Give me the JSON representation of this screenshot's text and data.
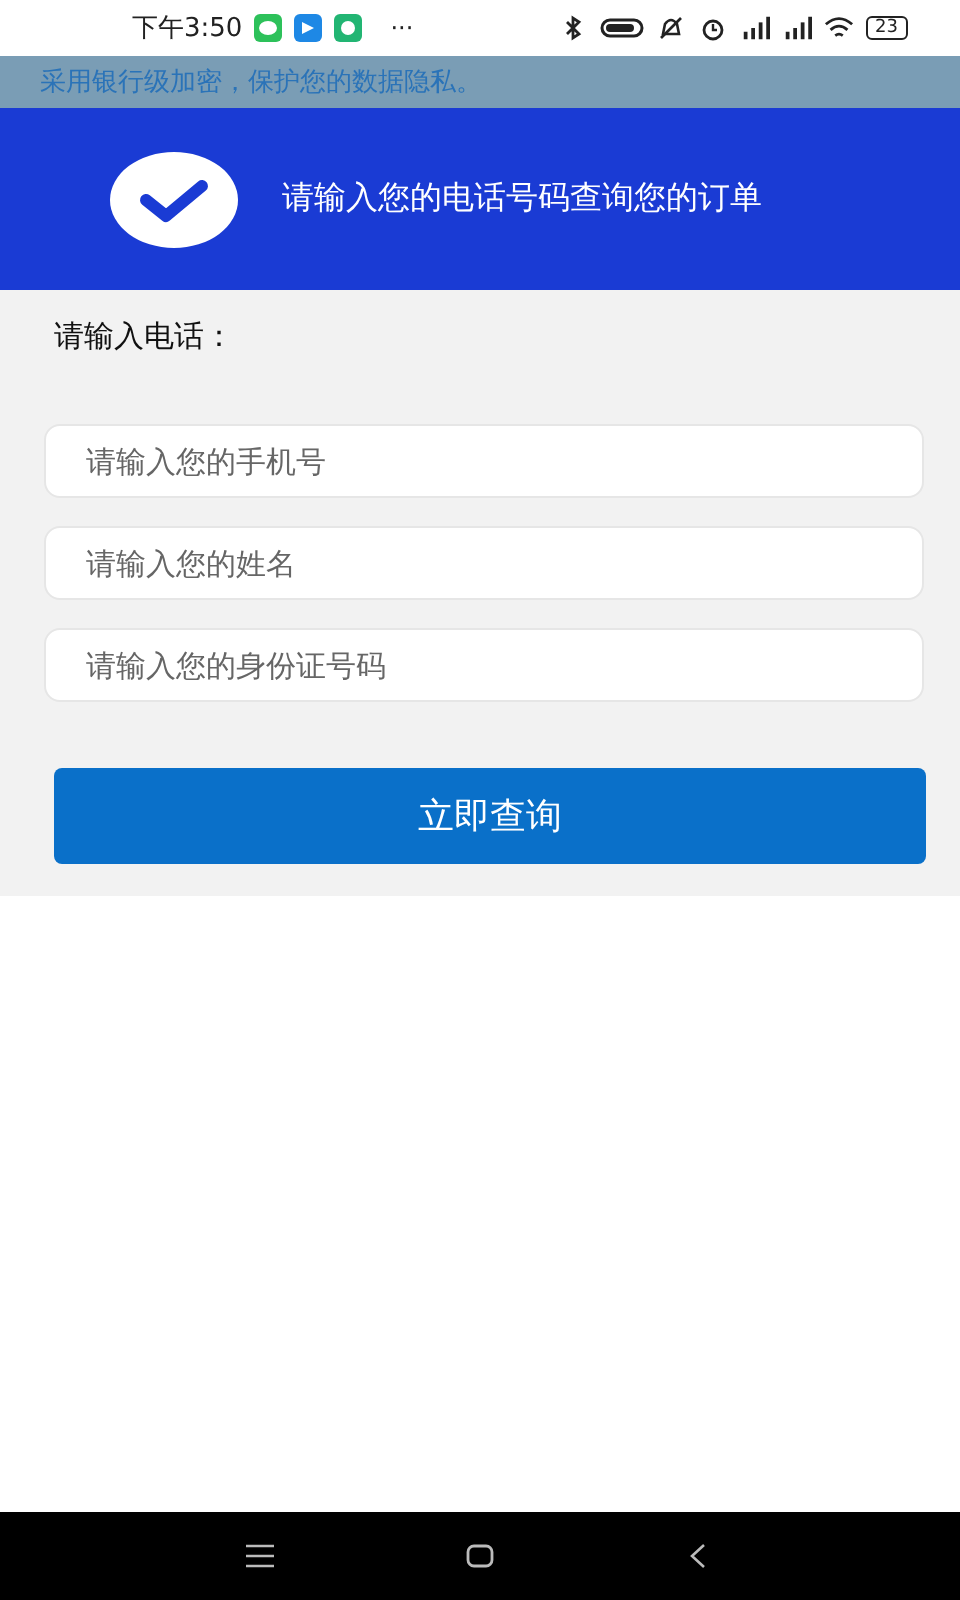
{
  "status_bar": {
    "time": "下午3:50",
    "more": "···",
    "battery": "23"
  },
  "notice": "采用银行级加密，保护您的数据隐私。",
  "header": {
    "title": "请输入您的电话号码查询您的订单"
  },
  "form": {
    "label": "请输入电话：",
    "fields": [
      {
        "placeholder": "请输入您的手机号"
      },
      {
        "placeholder": "请输入您的姓名"
      },
      {
        "placeholder": "请输入您的身份证号码"
      }
    ],
    "submit": "立即查询"
  }
}
